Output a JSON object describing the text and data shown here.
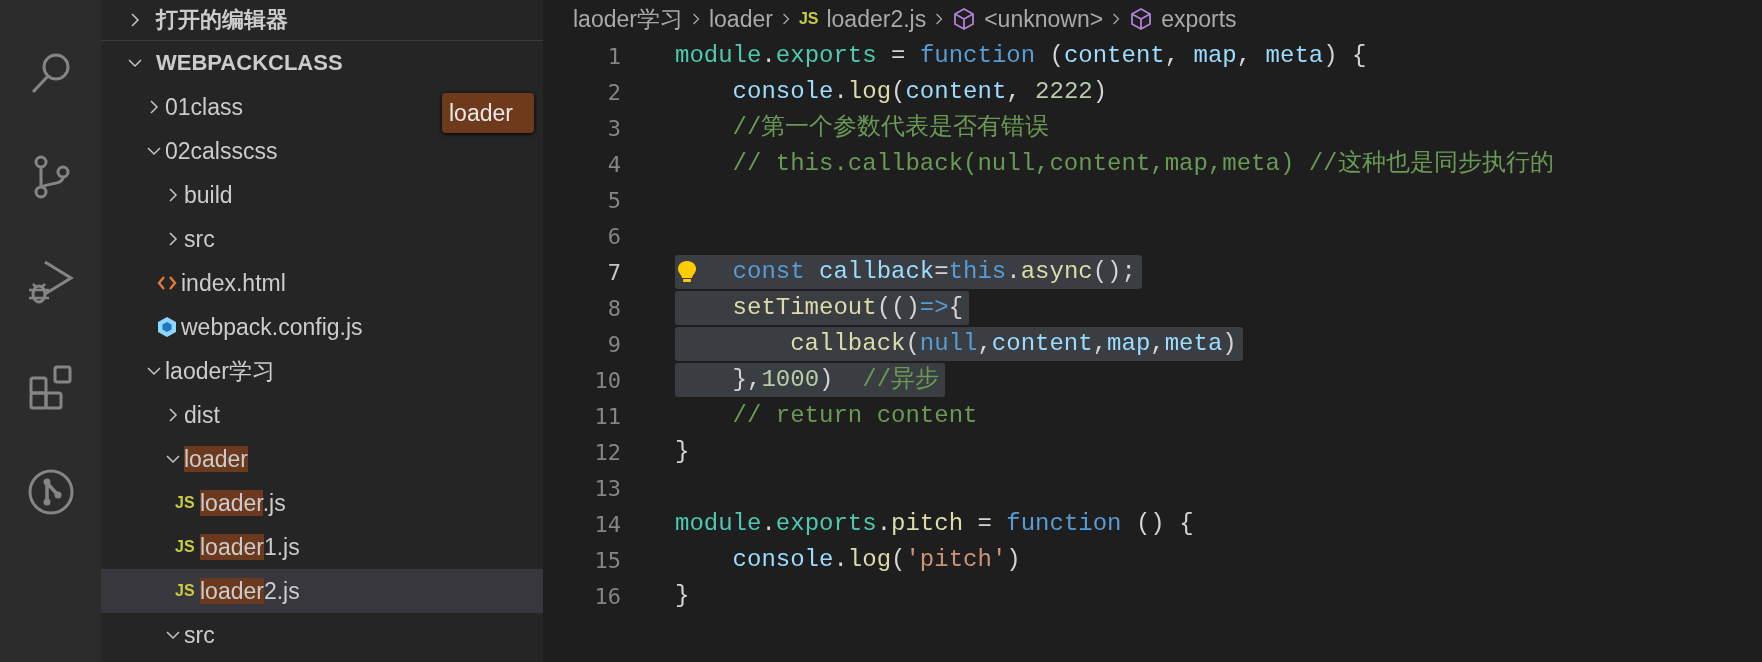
{
  "activity_bar": {
    "items": [
      {
        "kind": "search"
      },
      {
        "kind": "source-control"
      },
      {
        "kind": "run-debug"
      },
      {
        "kind": "extensions"
      },
      {
        "kind": "git-graph"
      }
    ]
  },
  "sidebar": {
    "sections": [
      {
        "title": "打开的编辑器",
        "expanded": false
      },
      {
        "title": "WEBPACKCLASS",
        "expanded": true
      }
    ],
    "filter": {
      "value": "loader"
    },
    "tree": [
      {
        "kind": "folder",
        "label": "01class",
        "expanded": false,
        "selected": false
      },
      {
        "kind": "folder",
        "label": "02calsscss",
        "expanded": true,
        "selected": false,
        "children": [
          {
            "kind": "folder",
            "label": "build",
            "expanded": false,
            "selected": false
          },
          {
            "kind": "folder",
            "label": "src",
            "expanded": false,
            "selected": false
          },
          {
            "kind": "html-file",
            "label": "index.html",
            "selected": false
          },
          {
            "kind": "webpack-file",
            "label": "webpack.config.js",
            "selected": false
          }
        ]
      },
      {
        "kind": "folder",
        "label": "laoder学习",
        "expanded": true,
        "selected": false,
        "children": [
          {
            "kind": "folder",
            "label": "dist",
            "expanded": false,
            "selected": false
          },
          {
            "kind": "folder",
            "parts": [
              {
                "text": "loader",
                "match": true
              }
            ],
            "expanded": true,
            "selected": false,
            "children": [
              {
                "kind": "js-file",
                "icon_text": "JS",
                "parts": [
                  {
                    "text": "loader",
                    "match": true
                  },
                  {
                    "text": ".js",
                    "match": false
                  }
                ],
                "selected": false
              },
              {
                "kind": "js-file",
                "icon_text": "JS",
                "parts": [
                  {
                    "text": "loader",
                    "match": true
                  },
                  {
                    "text": "1.js",
                    "match": false
                  }
                ],
                "selected": false
              },
              {
                "kind": "js-file",
                "icon_text": "JS",
                "parts": [
                  {
                    "text": "loader",
                    "match": true
                  },
                  {
                    "text": "2.js",
                    "match": false
                  }
                ],
                "selected": true
              }
            ]
          },
          {
            "kind": "folder",
            "label": "src",
            "expanded": true,
            "selected": false
          }
        ]
      }
    ]
  },
  "editor": {
    "breadcrumb": [
      {
        "text": "laoder学习",
        "kind": "folder"
      },
      {
        "text": "loader",
        "kind": "folder"
      },
      {
        "text": "loader2.js",
        "kind": "js-file",
        "icon_text": "JS"
      },
      {
        "text": "<unknown>",
        "kind": "symbol"
      },
      {
        "text": "exports",
        "kind": "symbol"
      }
    ],
    "lines": [
      {
        "number": "1",
        "active": false,
        "selected": false,
        "tokens": [
          {
            "text": "module",
            "kind": "type"
          },
          {
            "text": ".",
            "kind": "plain"
          },
          {
            "text": "exports",
            "kind": "type"
          },
          {
            "text": " = ",
            "kind": "plain"
          },
          {
            "text": "function",
            "kind": "keyword"
          },
          {
            "text": " (",
            "kind": "plain"
          },
          {
            "text": "content",
            "kind": "var"
          },
          {
            "text": ", ",
            "kind": "plain"
          },
          {
            "text": "map",
            "kind": "var"
          },
          {
            "text": ", ",
            "kind": "plain"
          },
          {
            "text": "meta",
            "kind": "var"
          },
          {
            "text": ") {",
            "kind": "plain"
          }
        ]
      },
      {
        "number": "2",
        "active": false,
        "selected": false,
        "tokens": [
          {
            "text": "    console",
            "kind": "var"
          },
          {
            "text": ".",
            "kind": "plain"
          },
          {
            "text": "log",
            "kind": "func"
          },
          {
            "text": "(",
            "kind": "plain"
          },
          {
            "text": "content",
            "kind": "var"
          },
          {
            "text": ", ",
            "kind": "plain"
          },
          {
            "text": "2222",
            "kind": "number"
          },
          {
            "text": ")",
            "kind": "plain"
          }
        ]
      },
      {
        "number": "3",
        "active": false,
        "selected": false,
        "tokens": [
          {
            "text": "    //第一个参数代表是否有错误",
            "kind": "comment"
          }
        ]
      },
      {
        "number": "4",
        "active": false,
        "selected": false,
        "tokens": [
          {
            "text": "    // this.callback(null,content,map,meta) //这种也是同步执行的",
            "kind": "comment"
          }
        ]
      },
      {
        "number": "5",
        "active": false,
        "selected": false
      },
      {
        "number": "6",
        "active": false,
        "selected": false
      },
      {
        "number": "7",
        "active": true,
        "selected": true,
        "lightbulb": true,
        "tokens": [
          {
            "text": "    const ",
            "kind": "keyword"
          },
          {
            "text": "callback",
            "kind": "var"
          },
          {
            "text": "=",
            "kind": "plain"
          },
          {
            "text": "this",
            "kind": "keyword"
          },
          {
            "text": ".",
            "kind": "plain"
          },
          {
            "text": "async",
            "kind": "func"
          },
          {
            "text": "();",
            "kind": "plain"
          }
        ]
      },
      {
        "number": "8",
        "active": false,
        "selected": true,
        "tokens": [
          {
            "text": "    setTimeout",
            "kind": "func"
          },
          {
            "text": "(()",
            "kind": "plain"
          },
          {
            "text": "=>",
            "kind": "keyword"
          },
          {
            "text": "{",
            "kind": "plain"
          }
        ]
      },
      {
        "number": "9",
        "active": false,
        "selected": true,
        "tokens": [
          {
            "text": "        callback",
            "kind": "func"
          },
          {
            "text": "(",
            "kind": "plain"
          },
          {
            "text": "null",
            "kind": "keyword"
          },
          {
            "text": ",",
            "kind": "plain"
          },
          {
            "text": "content",
            "kind": "var"
          },
          {
            "text": ",",
            "kind": "plain"
          },
          {
            "text": "map",
            "kind": "var"
          },
          {
            "text": ",",
            "kind": "plain"
          },
          {
            "text": "meta",
            "kind": "var"
          },
          {
            "text": ")",
            "kind": "plain"
          }
        ]
      },
      {
        "number": "10",
        "active": false,
        "selected": true,
        "tokens": [
          {
            "text": "    },",
            "kind": "plain"
          },
          {
            "text": "1000",
            "kind": "number"
          },
          {
            "text": ")  ",
            "kind": "plain"
          },
          {
            "text": "//异步",
            "kind": "comment"
          }
        ]
      },
      {
        "number": "11",
        "active": false,
        "selected": false,
        "tokens": [
          {
            "text": "    // return content",
            "kind": "comment"
          }
        ]
      },
      {
        "number": "12",
        "active": false,
        "selected": false,
        "tokens": [
          {
            "text": "}",
            "kind": "plain"
          }
        ]
      },
      {
        "number": "13",
        "active": false,
        "selected": false
      },
      {
        "number": "14",
        "active": false,
        "selected": false,
        "tokens": [
          {
            "text": "module",
            "kind": "type"
          },
          {
            "text": ".",
            "kind": "plain"
          },
          {
            "text": "exports",
            "kind": "type"
          },
          {
            "text": ".",
            "kind": "plain"
          },
          {
            "text": "pitch",
            "kind": "func"
          },
          {
            "text": " = ",
            "kind": "plain"
          },
          {
            "text": "function",
            "kind": "keyword"
          },
          {
            "text": " () {",
            "kind": "plain"
          }
        ]
      },
      {
        "number": "15",
        "active": false,
        "selected": false,
        "tokens": [
          {
            "text": "    console",
            "kind": "var"
          },
          {
            "text": ".",
            "kind": "plain"
          },
          {
            "text": "log",
            "kind": "func"
          },
          {
            "text": "(",
            "kind": "plain"
          },
          {
            "text": "'pitch'",
            "kind": "string"
          },
          {
            "text": ")",
            "kind": "plain"
          }
        ]
      },
      {
        "number": "16",
        "active": false,
        "selected": false,
        "tokens": [
          {
            "text": "}",
            "kind": "plain"
          }
        ]
      }
    ]
  }
}
